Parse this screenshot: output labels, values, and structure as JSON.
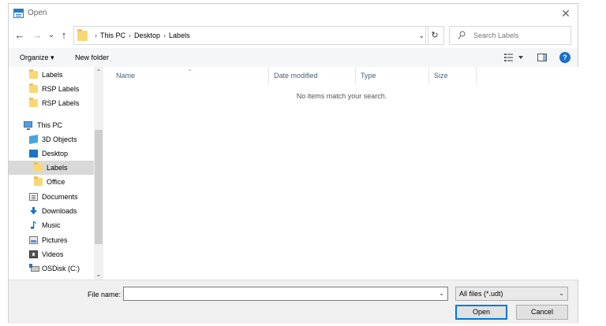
{
  "window": {
    "title": "Open",
    "close_glyph": "✕"
  },
  "navigation": {
    "back_glyph": "←",
    "forward_glyph": "→",
    "recent_glyph": "⌄",
    "up_glyph": "↑",
    "breadcrumbs": [
      "This PC",
      "Desktop",
      "Labels"
    ],
    "separator": "›",
    "refresh_glyph": "↻",
    "dropdown_glyph": "⌄"
  },
  "search": {
    "placeholder": "Search Labels"
  },
  "toolbar": {
    "organize_label": "Organize ▾",
    "new_folder_label": "New folder",
    "help_glyph": "?"
  },
  "sidebar": {
    "items": [
      {
        "label": "Labels",
        "icon": "folder-icon"
      },
      {
        "label": "RSP Labels",
        "icon": "folder-icon"
      },
      {
        "label": "RSP Labels",
        "icon": "folder-icon"
      },
      {
        "label": "This PC",
        "icon": "computer-icon"
      },
      {
        "label": "3D Objects",
        "icon": "cube-icon"
      },
      {
        "label": "Desktop",
        "icon": "desktop-icon"
      },
      {
        "label": "Labels",
        "icon": "folder-icon",
        "selected": true
      },
      {
        "label": "Office",
        "icon": "folder-icon"
      },
      {
        "label": "Documents",
        "icon": "document-icon"
      },
      {
        "label": "Downloads",
        "icon": "download-icon"
      },
      {
        "label": "Music",
        "icon": "music-note-icon"
      },
      {
        "label": "Pictures",
        "icon": "picture-icon"
      },
      {
        "label": "Videos",
        "icon": "video-icon"
      },
      {
        "label": "OSDisk (C:)",
        "icon": "disk-icon"
      }
    ],
    "scroll_up_glyph": "⌃",
    "scroll_down_glyph": "⌄"
  },
  "filelist": {
    "columns": [
      "Name",
      "Date modified",
      "Type",
      "Size"
    ],
    "sort_glyph": "⌃",
    "empty_message": "No items match your search."
  },
  "footer": {
    "file_name_label": "File name:",
    "file_name_value": "",
    "file_type_value": "All files  (*.udt)",
    "open_label": "Open",
    "cancel_label": "Cancel"
  },
  "colors": {
    "accent": "#0078d7",
    "folder": "#f8d775",
    "selection": "#d9d9d9"
  }
}
